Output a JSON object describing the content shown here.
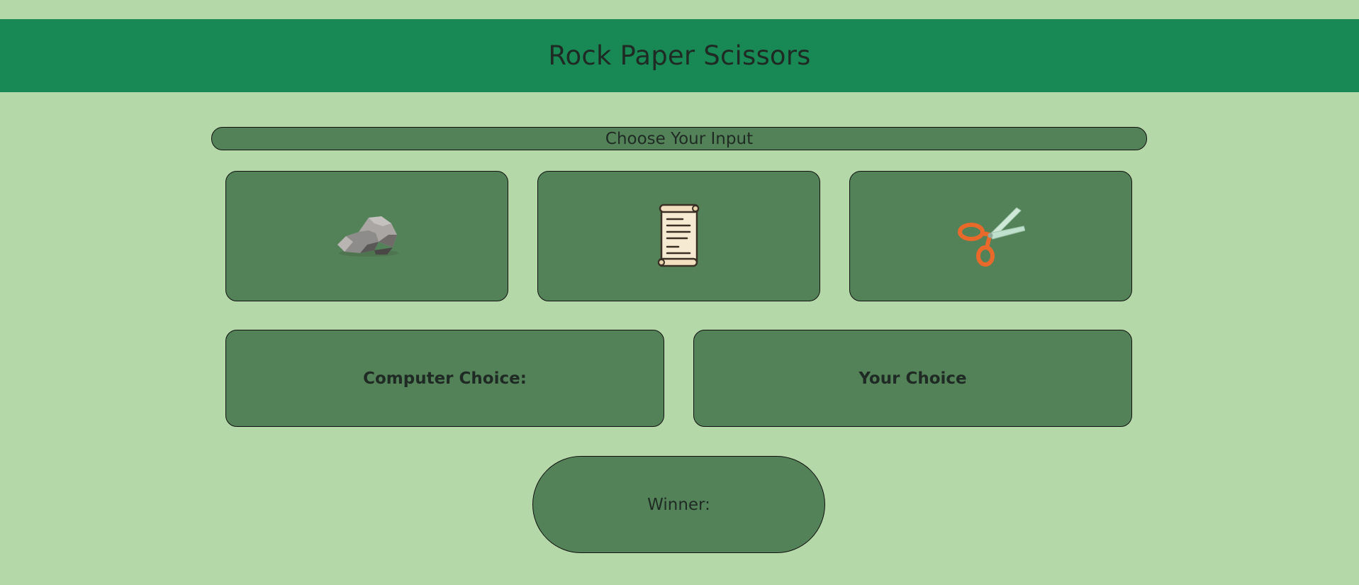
{
  "header": {
    "title": "Rock Paper Scissors"
  },
  "prompt": {
    "label": "Choose Your Input"
  },
  "choices": [
    {
      "name": "rock",
      "icon": "rock-icon"
    },
    {
      "name": "paper",
      "icon": "scroll-icon"
    },
    {
      "name": "scissors",
      "icon": "scissors-icon"
    }
  ],
  "results": {
    "computer_label": "Computer Choice:",
    "your_label": "Your Choice",
    "winner_label": "Winner:"
  },
  "colors": {
    "background": "#b5d8a8",
    "header": "#188954",
    "card": "#548258",
    "text": "#1f2a24"
  }
}
